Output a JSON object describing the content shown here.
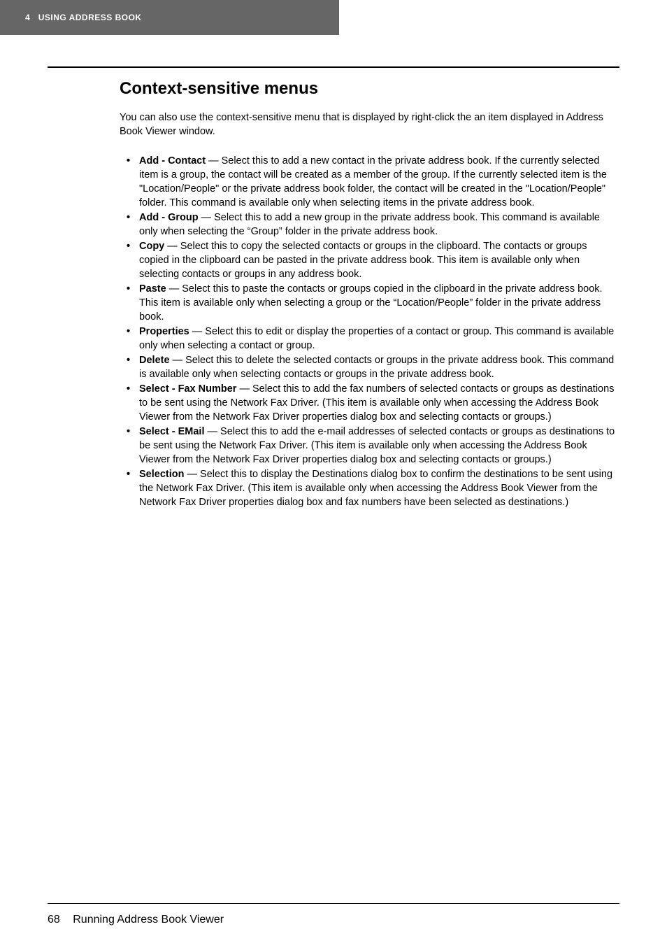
{
  "header": {
    "chapter_number": "4",
    "chapter_title": "USING ADDRESS BOOK"
  },
  "content": {
    "section_title": "Context-sensitive menus",
    "intro": "You can also use the context-sensitive menu that is displayed by right-click the an item displayed in Address Book Viewer window.",
    "items": [
      {
        "term": "Add - Contact",
        "desc": " — Select this to add a new contact in the private address book. If the currently selected item is a group, the contact will be created as a member of the group. If the currently selected item is the \"Location/People\" or the private address book folder, the contact will be created in the \"Location/People\" folder. This command is available only when selecting items in the private address book."
      },
      {
        "term": "Add - Group",
        "desc": " — Select this to add a new group in the private address book. This command is available only when selecting the “Group” folder in the private address book."
      },
      {
        "term": "Copy",
        "desc": " — Select this to copy the selected contacts or groups in the clipboard. The contacts or groups copied in the clipboard can be pasted in the private address book. This item is available only when selecting contacts or groups in any address book."
      },
      {
        "term": "Paste",
        "desc": " — Select this to paste the contacts or groups copied in the clipboard in the private address book. This item is available only when selecting a group or the “Location/People” folder in the private address book."
      },
      {
        "term": "Properties",
        "desc": " — Select this to edit or display the properties of a contact or group. This command is available only when selecting a contact or group."
      },
      {
        "term": "Delete",
        "desc": " — Select this to delete the selected contacts or groups in the private address book. This command is available only when selecting contacts or groups in the private address book."
      },
      {
        "term": "Select - Fax Number",
        "desc": " — Select this to add the fax numbers of selected contacts or groups as destinations to be sent using the Network Fax Driver. (This item is available only when accessing the Address Book Viewer from the Network Fax Driver properties dialog box and selecting contacts or groups.)"
      },
      {
        "term": "Select - EMail",
        "desc": " — Select this to add the e-mail addresses of selected contacts or groups as destinations to be sent using the Network Fax Driver. (This item is available only when accessing the Address Book Viewer from the Network Fax Driver properties dialog box and selecting contacts or groups.)"
      },
      {
        "term": "Selection",
        "desc": " — Select this to display the Destinations dialog box to confirm the destinations to be sent using the Network Fax Driver. (This item is available only when accessing the Address Book Viewer from the Network Fax Driver properties dialog box and fax numbers have been selected as destinations.)"
      }
    ]
  },
  "footer": {
    "page_number": "68",
    "section_name": "Running Address Book Viewer"
  }
}
